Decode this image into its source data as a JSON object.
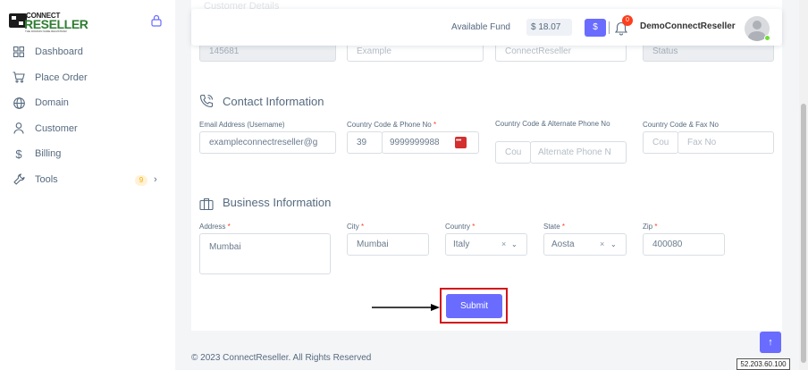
{
  "brand": {
    "line1": "CONNECT",
    "line2": "RESELLER",
    "tagline": "THE DOMAIN NAME REGISTRAR"
  },
  "sidebar": {
    "items": [
      {
        "label": "Dashboard",
        "icon": "grid-icon"
      },
      {
        "label": "Place Order",
        "icon": "cart-icon"
      },
      {
        "label": "Domain",
        "icon": "globe-icon"
      },
      {
        "label": "Customer",
        "icon": "user-icon"
      },
      {
        "label": "Billing",
        "icon": "dollar-icon"
      },
      {
        "label": "Tools",
        "icon": "wrench-icon",
        "badge": "9"
      }
    ]
  },
  "topbar": {
    "fund_label": "Available Fund",
    "fund_value": "$ 18.07",
    "dollar_button": "$",
    "notification_count": "0",
    "username": "DemoConnectReseller"
  },
  "form": {
    "ghost_title": "Customer Details",
    "top_row": {
      "field1": "145681",
      "field2": "Example",
      "field3": "ConnectReseller",
      "field4": "Status"
    },
    "contact": {
      "title": "Contact Information",
      "email_label": "Email Address (Username)",
      "email_value": "exampleconnectreseller@g",
      "phone_label": "Country Code & Phone No",
      "phone_code": "39",
      "phone_number": "9999999988",
      "alt_phone_label": "Country Code & Alternate Phone No",
      "alt_code_placeholder": "Cou",
      "alt_phone_placeholder": "Alternate Phone N",
      "fax_label": "Country Code & Fax No",
      "fax_code_placeholder": "Cou",
      "fax_placeholder": "Fax No"
    },
    "business": {
      "title": "Business Information",
      "address_label": "Address",
      "address_value": "Mumbai",
      "city_label": "City",
      "city_value": "Mumbai",
      "country_label": "Country",
      "country_value": "Italy",
      "state_label": "State",
      "state_value": "Aosta",
      "zip_label": "Zip",
      "zip_value": "400080"
    },
    "required_mark": "*",
    "submit_label": "Submit"
  },
  "footer": {
    "text": "© 2023 ConnectReseller. All Rights Reserved"
  },
  "scroll_top_glyph": "↑",
  "ip_tag": "52.203.60.100",
  "colors": {
    "accent": "#696cff",
    "highlight_frame": "#d4141a",
    "brand_green": "#2e7d32"
  }
}
